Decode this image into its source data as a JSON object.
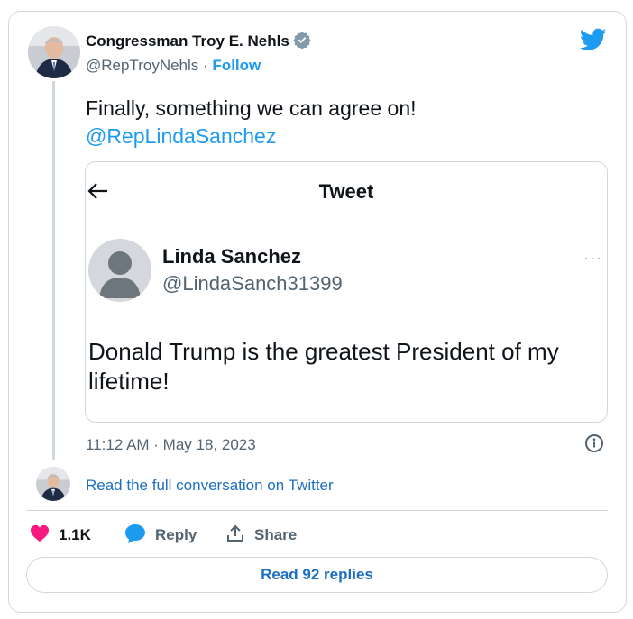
{
  "author": {
    "name": "Congressman Troy E. Nehls",
    "handle": "@RepTroyNehls",
    "separator": "·",
    "follow_label": "Follow"
  },
  "tweet": {
    "text": "Finally, something we can agree on!",
    "mention": "@RepLindaSanchez",
    "timestamp": "11:12 AM · May 18, 2023"
  },
  "quoted": {
    "header_title": "Tweet",
    "name": "Linda Sanchez",
    "handle": "@LindaSanch31399",
    "more": "···",
    "text": "Donald Trump is the greatest President of my lifetime!"
  },
  "conversation_link": "Read the full conversation on Twitter",
  "actions": {
    "likes": "1.1K",
    "reply_label": "Reply",
    "share_label": "Share"
  },
  "read_replies_label": "Read 92 replies",
  "colors": {
    "accent": "#1d9bf0",
    "heart": "#f91880",
    "border": "#cfd9de"
  },
  "icons": [
    "twitter-bird-icon",
    "verified-badge-icon",
    "back-arrow-icon",
    "info-icon",
    "heart-icon",
    "reply-icon",
    "share-icon"
  ]
}
